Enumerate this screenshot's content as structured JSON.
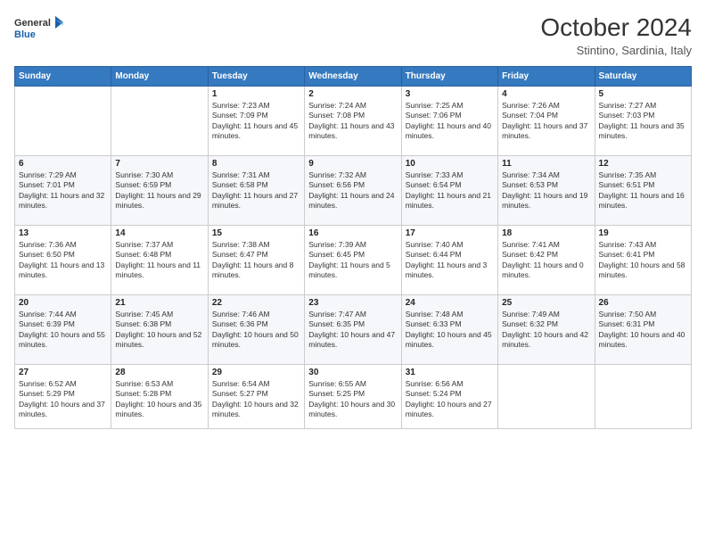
{
  "header": {
    "logo_line1": "General",
    "logo_line2": "Blue",
    "title": "October 2024",
    "subtitle": "Stintino, Sardinia, Italy"
  },
  "weekdays": [
    "Sunday",
    "Monday",
    "Tuesday",
    "Wednesday",
    "Thursday",
    "Friday",
    "Saturday"
  ],
  "weeks": [
    [
      {
        "day": "",
        "text": ""
      },
      {
        "day": "",
        "text": ""
      },
      {
        "day": "1",
        "text": "Sunrise: 7:23 AM\nSunset: 7:09 PM\nDaylight: 11 hours and 45 minutes."
      },
      {
        "day": "2",
        "text": "Sunrise: 7:24 AM\nSunset: 7:08 PM\nDaylight: 11 hours and 43 minutes."
      },
      {
        "day": "3",
        "text": "Sunrise: 7:25 AM\nSunset: 7:06 PM\nDaylight: 11 hours and 40 minutes."
      },
      {
        "day": "4",
        "text": "Sunrise: 7:26 AM\nSunset: 7:04 PM\nDaylight: 11 hours and 37 minutes."
      },
      {
        "day": "5",
        "text": "Sunrise: 7:27 AM\nSunset: 7:03 PM\nDaylight: 11 hours and 35 minutes."
      }
    ],
    [
      {
        "day": "6",
        "text": "Sunrise: 7:29 AM\nSunset: 7:01 PM\nDaylight: 11 hours and 32 minutes."
      },
      {
        "day": "7",
        "text": "Sunrise: 7:30 AM\nSunset: 6:59 PM\nDaylight: 11 hours and 29 minutes."
      },
      {
        "day": "8",
        "text": "Sunrise: 7:31 AM\nSunset: 6:58 PM\nDaylight: 11 hours and 27 minutes."
      },
      {
        "day": "9",
        "text": "Sunrise: 7:32 AM\nSunset: 6:56 PM\nDaylight: 11 hours and 24 minutes."
      },
      {
        "day": "10",
        "text": "Sunrise: 7:33 AM\nSunset: 6:54 PM\nDaylight: 11 hours and 21 minutes."
      },
      {
        "day": "11",
        "text": "Sunrise: 7:34 AM\nSunset: 6:53 PM\nDaylight: 11 hours and 19 minutes."
      },
      {
        "day": "12",
        "text": "Sunrise: 7:35 AM\nSunset: 6:51 PM\nDaylight: 11 hours and 16 minutes."
      }
    ],
    [
      {
        "day": "13",
        "text": "Sunrise: 7:36 AM\nSunset: 6:50 PM\nDaylight: 11 hours and 13 minutes."
      },
      {
        "day": "14",
        "text": "Sunrise: 7:37 AM\nSunset: 6:48 PM\nDaylight: 11 hours and 11 minutes."
      },
      {
        "day": "15",
        "text": "Sunrise: 7:38 AM\nSunset: 6:47 PM\nDaylight: 11 hours and 8 minutes."
      },
      {
        "day": "16",
        "text": "Sunrise: 7:39 AM\nSunset: 6:45 PM\nDaylight: 11 hours and 5 minutes."
      },
      {
        "day": "17",
        "text": "Sunrise: 7:40 AM\nSunset: 6:44 PM\nDaylight: 11 hours and 3 minutes."
      },
      {
        "day": "18",
        "text": "Sunrise: 7:41 AM\nSunset: 6:42 PM\nDaylight: 11 hours and 0 minutes."
      },
      {
        "day": "19",
        "text": "Sunrise: 7:43 AM\nSunset: 6:41 PM\nDaylight: 10 hours and 58 minutes."
      }
    ],
    [
      {
        "day": "20",
        "text": "Sunrise: 7:44 AM\nSunset: 6:39 PM\nDaylight: 10 hours and 55 minutes."
      },
      {
        "day": "21",
        "text": "Sunrise: 7:45 AM\nSunset: 6:38 PM\nDaylight: 10 hours and 52 minutes."
      },
      {
        "day": "22",
        "text": "Sunrise: 7:46 AM\nSunset: 6:36 PM\nDaylight: 10 hours and 50 minutes."
      },
      {
        "day": "23",
        "text": "Sunrise: 7:47 AM\nSunset: 6:35 PM\nDaylight: 10 hours and 47 minutes."
      },
      {
        "day": "24",
        "text": "Sunrise: 7:48 AM\nSunset: 6:33 PM\nDaylight: 10 hours and 45 minutes."
      },
      {
        "day": "25",
        "text": "Sunrise: 7:49 AM\nSunset: 6:32 PM\nDaylight: 10 hours and 42 minutes."
      },
      {
        "day": "26",
        "text": "Sunrise: 7:50 AM\nSunset: 6:31 PM\nDaylight: 10 hours and 40 minutes."
      }
    ],
    [
      {
        "day": "27",
        "text": "Sunrise: 6:52 AM\nSunset: 5:29 PM\nDaylight: 10 hours and 37 minutes."
      },
      {
        "day": "28",
        "text": "Sunrise: 6:53 AM\nSunset: 5:28 PM\nDaylight: 10 hours and 35 minutes."
      },
      {
        "day": "29",
        "text": "Sunrise: 6:54 AM\nSunset: 5:27 PM\nDaylight: 10 hours and 32 minutes."
      },
      {
        "day": "30",
        "text": "Sunrise: 6:55 AM\nSunset: 5:25 PM\nDaylight: 10 hours and 30 minutes."
      },
      {
        "day": "31",
        "text": "Sunrise: 6:56 AM\nSunset: 5:24 PM\nDaylight: 10 hours and 27 minutes."
      },
      {
        "day": "",
        "text": ""
      },
      {
        "day": "",
        "text": ""
      }
    ]
  ]
}
